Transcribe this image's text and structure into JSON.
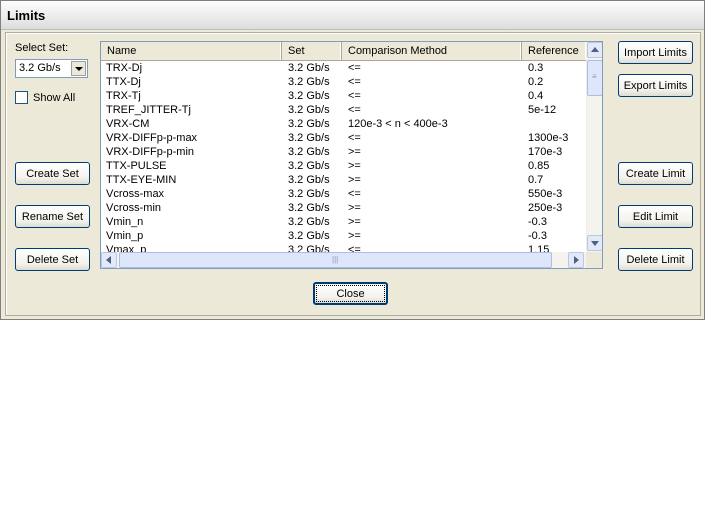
{
  "window": {
    "title": "Limits"
  },
  "left_panel": {
    "select_set_label": "Select Set:",
    "selected_set": "3.2 Gb/s",
    "show_all_label": "Show All",
    "create_set": "Create Set",
    "rename_set": "Rename Set",
    "delete_set": "Delete Set"
  },
  "right_panel": {
    "import_limits": "Import Limits",
    "export_limits": "Export Limits",
    "create_limit": "Create Limit",
    "edit_limit": "Edit Limit",
    "delete_limit": "Delete Limit"
  },
  "table": {
    "columns": [
      "Name",
      "Set",
      "Comparison Method",
      "Reference"
    ],
    "rows": [
      [
        "TRX-Dj",
        "3.2 Gb/s",
        "<=",
        "0.3"
      ],
      [
        "TTX-Dj",
        "3.2 Gb/s",
        "<=",
        "0.2"
      ],
      [
        "TRX-Tj",
        "3.2 Gb/s",
        "<=",
        "0.4"
      ],
      [
        "TREF_JITTER-Tj",
        "3.2 Gb/s",
        "<=",
        "5e-12"
      ],
      [
        "VRX-CM",
        "3.2 Gb/s",
        "120e-3 < n < 400e-3",
        ""
      ],
      [
        "VRX-DIFFp-p-max",
        "3.2 Gb/s",
        "<=",
        "1300e-3"
      ],
      [
        "VRX-DIFFp-p-min",
        "3.2 Gb/s",
        ">=",
        "170e-3"
      ],
      [
        "TTX-PULSE",
        "3.2 Gb/s",
        ">=",
        "0.85"
      ],
      [
        "TTX-EYE-MIN",
        "3.2 Gb/s",
        ">=",
        "0.7"
      ],
      [
        "Vcross-max",
        "3.2 Gb/s",
        "<=",
        "550e-3"
      ],
      [
        "Vcross-min",
        "3.2 Gb/s",
        ">=",
        "250e-3"
      ],
      [
        "Vmin_n",
        "3.2 Gb/s",
        ">=",
        "-0.3"
      ],
      [
        "Vmin_p",
        "3.2 Gb/s",
        ">=",
        "-0.3"
      ],
      [
        "Vmax_p",
        "3.2 Gb/s",
        "<=",
        "1.15"
      ]
    ]
  },
  "footer": {
    "close": "Close"
  }
}
